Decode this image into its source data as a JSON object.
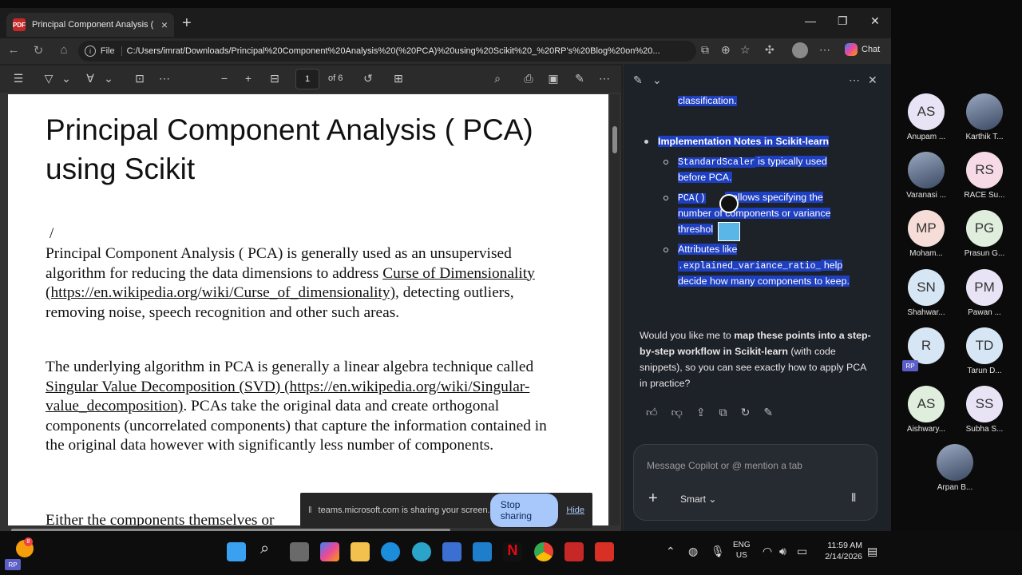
{
  "browser": {
    "tab_title": "Principal Component Analysis ( PC",
    "tab_favicon_text": "PDF",
    "new_tab_symbol": "+",
    "address_scheme": "File",
    "address_url": "C:/Users/imrat/Downloads/Principal%20Component%20Analysis%20(%20PCA)%20using%20Scikit%20_%20RP's%20Blog%20on%20...",
    "chat_label": "Chat"
  },
  "pdf_toolbar": {
    "page_current": "1",
    "page_total": "of 6"
  },
  "document": {
    "title": "Principal Component Analysis ( PCA) using Scikit",
    "slash": "/",
    "para1_text1": "Principal Component Analysis ( PCA) is generally used as an unsupervised algorithm for reducing the data dimensions to address ",
    "para1_link1": "Curse of Dimensionality (https://en.wikipedia.org/wiki/Curse_of_dimensionality)",
    "para1_text2": ", detecting outliers, removing noise, speech recognition and other such areas.",
    "para2_text1": "The underlying algorithm in PCA is generally a linear algebra technique called ",
    "para2_link1": "Singular Value Decomposition (SVD) (https://en.wikipedia.org/wiki/Singular-value_decomposition)",
    "para2_text2": ". PCAs take the original data and create orthogonal components (uncorrelated components) that capture the information contained in the original data however with significantly less number of components.",
    "para3_text": "Either the components themselves or"
  },
  "share_banner": {
    "message": "teams.microsoft.com is sharing your screen.",
    "stop_label": "Stop sharing",
    "hide_label": "Hide"
  },
  "copilot": {
    "line_top": "classification.",
    "section_heading": "Implementation Notes in Scikit-learn",
    "item1_code": "StandardScaler",
    "item1_text_a": " is typically used",
    "item1_text_b": "before PCA.",
    "item2_code": "PCA()",
    "item2_text_a": "s allows specifying the",
    "item2_text_b": "number of components or variance",
    "item2_text_c": "threshol",
    "item3_text_a": "Attributes like",
    "item3_code": ".explained_variance_ratio_",
    "item3_text_b": " help",
    "item3_text_c": "decide how many components to keep.",
    "question_pre": "Would you like me to ",
    "question_bold": "map these points into a step-by-step workflow in Scikit-learn",
    "question_post": " (with code snippets), so you can see exactly how to apply PCA in practice?",
    "input_placeholder": "Message Copilot or @ mention a tab",
    "mode_label": "Smart"
  },
  "participants": [
    {
      "initials": "AS",
      "name": "Anupam ...",
      "color": "#e9e4f5"
    },
    {
      "initials": "",
      "name": "Karthik T...",
      "color": "#6b7f99"
    },
    {
      "initials": "",
      "name": "Varanasi ...",
      "color": "#8a6a4a"
    },
    {
      "initials": "RS",
      "name": "RACE Su...",
      "color": "#f6dbe6"
    },
    {
      "initials": "MP",
      "name": "Moham...",
      "color": "#f7ddd8"
    },
    {
      "initials": "PG",
      "name": "Prasun G...",
      "color": "#dfeedd"
    },
    {
      "initials": "SN",
      "name": "Shahwar...",
      "color": "#d7e6f5"
    },
    {
      "initials": "PM",
      "name": "Pawan ...",
      "color": "#e9e4f5"
    },
    {
      "initials": "R",
      "name": "",
      "color": "#d7e6f5"
    },
    {
      "initials": "TD",
      "name": "Tarun D...",
      "color": "#d7e6f5"
    },
    {
      "initials": "AS",
      "name": "Aishwary...",
      "color": "#dfeedd"
    },
    {
      "initials": "SS",
      "name": "Subha S...",
      "color": "#e9e4f5"
    },
    {
      "initials": "",
      "name": "Arpan B...",
      "color": "#3b4a63"
    }
  ],
  "badges": {
    "rp": "RP",
    "notif_count": "8"
  },
  "taskbar": {
    "lang_top": "ENG",
    "lang_bottom": "US",
    "time": "11:59 AM",
    "date": "2/14/2026"
  }
}
